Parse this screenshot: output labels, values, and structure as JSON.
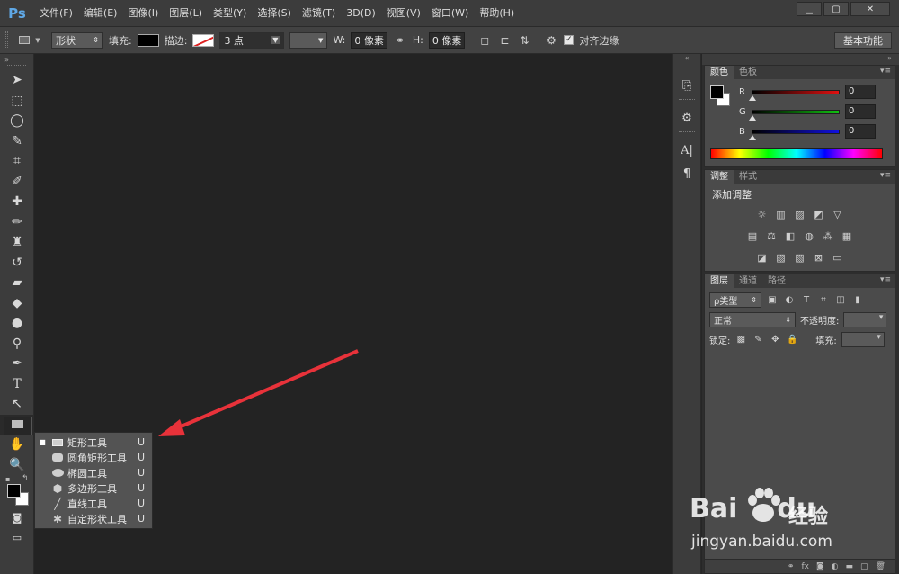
{
  "app": {
    "logo": "Ps"
  },
  "menu": [
    "文件(F)",
    "编辑(E)",
    "图像(I)",
    "图层(L)",
    "类型(Y)",
    "选择(S)",
    "滤镜(T)",
    "3D(D)",
    "视图(V)",
    "窗口(W)",
    "帮助(H)"
  ],
  "window_controls": {
    "minimize": "▁",
    "restore": "▢",
    "close": "✕"
  },
  "options": {
    "mode": "形状",
    "fill_label": "填充:",
    "stroke_label": "描边:",
    "stroke_width": "3 点",
    "w_label": "W:",
    "w_value": "0 像素",
    "h_label": "H:",
    "h_value": "0 像素",
    "align_edges": "对齐边缘",
    "workspace": "基本功能"
  },
  "flyout": {
    "items": [
      {
        "label": "矩形工具",
        "key": "U",
        "selected": true,
        "icon": "rectangle-icon"
      },
      {
        "label": "圆角矩形工具",
        "key": "U",
        "selected": false,
        "icon": "rounded-rectangle-icon"
      },
      {
        "label": "椭圆工具",
        "key": "U",
        "selected": false,
        "icon": "ellipse-icon"
      },
      {
        "label": "多边形工具",
        "key": "U",
        "selected": false,
        "icon": "polygon-icon"
      },
      {
        "label": "直线工具",
        "key": "U",
        "selected": false,
        "icon": "line-icon"
      },
      {
        "label": "自定形状工具",
        "key": "U",
        "selected": false,
        "icon": "custom-shape-icon"
      }
    ]
  },
  "color_panel": {
    "tabs": [
      "颜色",
      "色板"
    ],
    "r_label": "R",
    "r_value": "0",
    "g_label": "G",
    "g_value": "0",
    "b_label": "B",
    "b_value": "0",
    "colors": {
      "r": "#e01010",
      "g": "#10c010",
      "b": "#1010e0"
    }
  },
  "adjust_panel": {
    "tabs": [
      "调整",
      "样式"
    ],
    "title": "添加调整"
  },
  "layers_panel": {
    "tabs": [
      "图层",
      "通道",
      "路径"
    ],
    "filter": "ρ类型",
    "blend_mode": "正常",
    "opacity_label": "不透明度:",
    "lock_label": "锁定:",
    "fill_label": "填充:"
  },
  "watermark": {
    "logo": "Bai",
    "suffix": "du",
    "name": "经验",
    "url": "jingyan.baidu.com"
  }
}
